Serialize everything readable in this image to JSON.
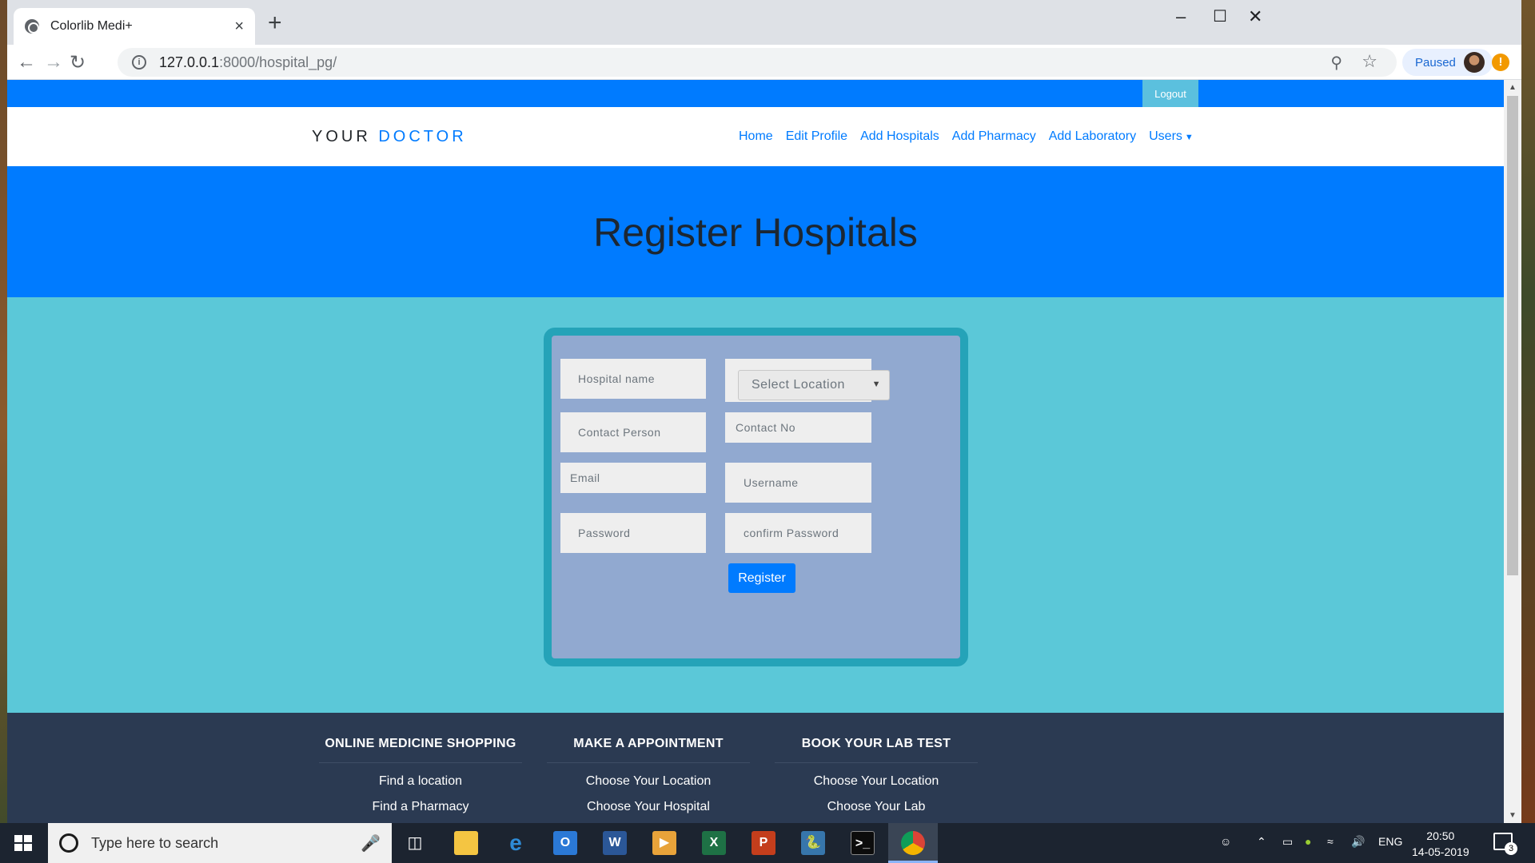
{
  "browser": {
    "tab_title": "Colorlib Medi+",
    "tab_close": "×",
    "new_tab": "+",
    "url_host": "127.0.0.1",
    "url_rest": ":8000/hospital_pg/",
    "profile_label": "Paused",
    "alert_glyph": "!"
  },
  "site": {
    "logout_label": "Logout",
    "brand_plain": "YOUR",
    "brand_accent": "DOCTOR",
    "nav": {
      "home": "Home",
      "edit_profile": "Edit Profile",
      "add_hospitals": "Add Hospitals",
      "add_pharmacy": "Add Pharmacy",
      "add_laboratory": "Add Laboratory",
      "users": "Users"
    },
    "hero_title": "Register Hospitals"
  },
  "form": {
    "hospital_name": "Hospital name",
    "select_location": "Select Location",
    "contact_person": "Contact Person",
    "contact_no": "Contact No",
    "email": "Email",
    "username": "Username",
    "password": "Password",
    "confirm_password": "confirm Password",
    "register_label": "Register"
  },
  "footer": {
    "col1": {
      "heading": "ONLINE MEDICINE SHOPPING",
      "links": [
        "Find a location",
        "Find a Pharmacy"
      ]
    },
    "col2": {
      "heading": "MAKE A APPOINTMENT",
      "links": [
        "Choose Your Location",
        "Choose Your Hospital"
      ]
    },
    "col3": {
      "heading": "BOOK YOUR LAB TEST",
      "links": [
        "Choose Your Location",
        "Choose Your Lab"
      ]
    }
  },
  "taskbar": {
    "search_placeholder": "Type here to search",
    "language": "ENG",
    "time": "20:50",
    "date": "14-05-2019",
    "notification_count": "3"
  },
  "colors": {
    "primary": "#007bff",
    "hero_text": "#1c2733",
    "content_bg": "#5bc8d8",
    "form_border": "#25a3b8",
    "form_bg": "#91a9d0",
    "logout_bg": "#5bc0de",
    "footer_bg": "#2b3a52"
  }
}
